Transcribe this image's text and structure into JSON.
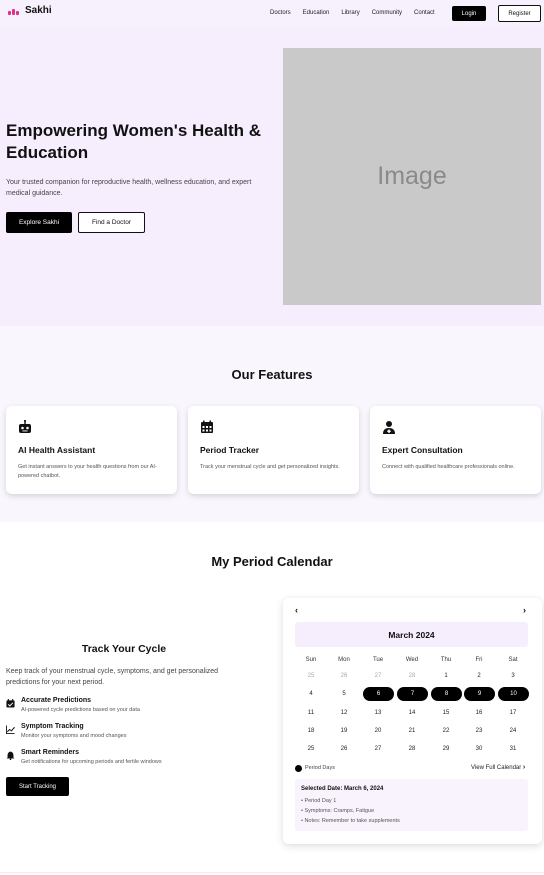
{
  "nav": {
    "brand": "Sakhi",
    "links": [
      "Doctors",
      "Education",
      "Library",
      "Community",
      "Contact"
    ],
    "login": "Login",
    "register": "Register"
  },
  "hero": {
    "title": "Empowering Women's Health & Education",
    "subtitle": "Your trusted companion for reproductive health, wellness education, and expert medical guidance.",
    "explore": "Explore Sakhi",
    "find_doctor": "Find a Doctor",
    "image_label": "Image"
  },
  "features": {
    "title": "Our Features",
    "cards": [
      {
        "title": "AI Health Assistant",
        "desc": "Get instant answers to your health questions from our AI-powered chatbot.",
        "icon": "robot-icon"
      },
      {
        "title": "Period Tracker",
        "desc": "Track your menstrual cycle and get personalized insights.",
        "icon": "calendar-icon"
      },
      {
        "title": "Expert Consultation",
        "desc": "Connect with qualified healthcare professionals online.",
        "icon": "doctor-icon"
      }
    ]
  },
  "calendar_section": {
    "title": "My Period Calendar",
    "track_title": "Track Your Cycle",
    "track_desc": "Keep track of your menstrual cycle, symptoms, and get personalized predictions for your next period.",
    "items": [
      {
        "title": "Accurate Predictions",
        "desc": "AI-powered cycle predictions based on your data",
        "icon": "calendar-check-icon"
      },
      {
        "title": "Symptom Tracking",
        "desc": "Monitor your symptoms and mood changes",
        "icon": "trend-chart-icon"
      },
      {
        "title": "Smart Reminders",
        "desc": "Get notifications for upcoming periods and fertile windows",
        "icon": "bell-icon"
      }
    ],
    "start_button": "Start Tracking"
  },
  "calendar": {
    "prev": "‹",
    "next": "›",
    "month": "March 2024",
    "weekdays": [
      "Sun",
      "Mon",
      "Tue",
      "Wed",
      "Thu",
      "Fri",
      "Sat"
    ],
    "weeks": [
      [
        "25",
        "26",
        "27",
        "28",
        "1",
        "2",
        "3"
      ],
      [
        "4",
        "5",
        "6",
        "7",
        "8",
        "9",
        "10"
      ],
      [
        "11",
        "12",
        "13",
        "14",
        "15",
        "16",
        "17"
      ],
      [
        "18",
        "19",
        "20",
        "21",
        "22",
        "23",
        "24"
      ],
      [
        "25",
        "26",
        "27",
        "28",
        "29",
        "30",
        "31"
      ]
    ],
    "muted_first_week": 4,
    "period_days": [
      "6",
      "7",
      "8",
      "9",
      "10"
    ],
    "legend": "Period Days",
    "view_full": "View Full Calendar",
    "selected": {
      "title": "Selected Date: March 6, 2024",
      "lines": [
        "• Period Day 1",
        "• Symptoms: Cramps, Fatigue",
        "• Notes: Remember to take supplements"
      ]
    }
  }
}
